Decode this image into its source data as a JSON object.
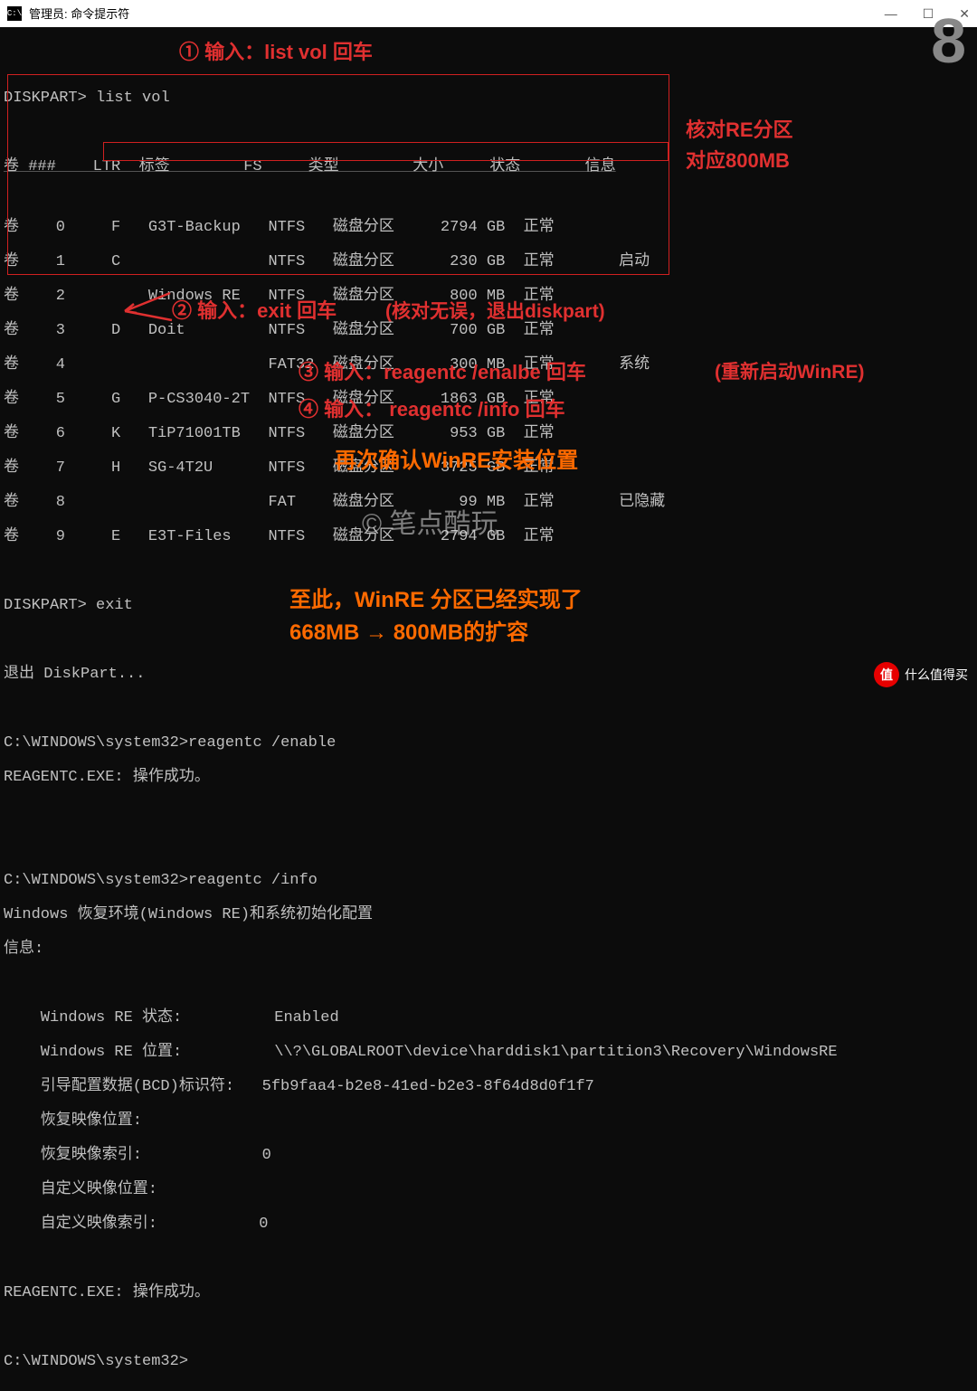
{
  "window": {
    "title": "管理员: 命令提示符",
    "icon_text": "C:\\"
  },
  "step_number": "8",
  "prompt1": "DISKPART> ",
  "command1": "list vol",
  "anno1": "① 输入：list vol 回车",
  "table_header": "卷 ###    LTR  标签        FS     类型        大小     状态       信息",
  "volumes": [
    {
      "line": "卷    0     F   G3T-Backup   NTFS   磁盘分区     2794 GB  正常"
    },
    {
      "line": "卷    1     C                NTFS   磁盘分区      230 GB  正常       启动"
    },
    {
      "line": "卷    2         Windows RE   NTFS   磁盘分区      800 MB  正常"
    },
    {
      "line": "卷    3     D   Doit         NTFS   磁盘分区      700 GB  正常"
    },
    {
      "line": "卷    4                      FAT32  磁盘分区      300 MB  正常       系统"
    },
    {
      "line": "卷    5     G   P-CS3040-2T  NTFS   磁盘分区     1863 GB  正常"
    },
    {
      "line": "卷    6     K   TiP71001TB   NTFS   磁盘分区      953 GB  正常"
    },
    {
      "line": "卷    7     H   SG-4T2U      NTFS   磁盘分区     3725 GB  正常"
    },
    {
      "line": "卷    8                      FAT    磁盘分区       99 MB  正常       已隐藏"
    },
    {
      "line": "卷    9     E   E3T-Files    NTFS   磁盘分区     2794 GB  正常"
    }
  ],
  "anno_check_re": "核对RE分区",
  "anno_check_re2": "对应800MB",
  "prompt2": "DISKPART> ",
  "command2": "exit",
  "exit_msg": "退出 DiskPart...",
  "anno2": "② 输入：exit 回车",
  "anno2_note": "(核对无误，退出diskpart)",
  "prompt3": "C:\\WINDOWS\\system32>",
  "command3": "reagentc /enable",
  "enable_result": "REAGENTC.EXE: 操作成功。",
  "anno3": "③ 输入：reagentc /enalbe 回车",
  "anno3_note": "(重新启动WinRE)",
  "prompt4": "C:\\WINDOWS\\system32>",
  "command4": "reagentc /info",
  "anno4": "④ 输入： reagentc /info 回车",
  "info_header": "Windows 恢复环境(Windows RE)和系统初始化配置",
  "info_label": "信息:",
  "anno_confirm": "再次确认WinRE安装位置",
  "info_rows": {
    "status_label": "    Windows RE 状态:          Enabled",
    "location_label": "    Windows RE 位置:          \\\\?\\GLOBALROOT\\device\\harddisk1\\partition3\\Recovery\\WindowsRE",
    "bcd_label": "    引导配置数据(BCD)标识符:   5fb9faa4-b2e8-41ed-b2e3-8f64d8d0f1f7",
    "recovery_img": "    恢复映像位置:",
    "recovery_idx": "    恢复映像索引:             0",
    "custom_img": "    自定义映像位置:",
    "custom_idx": "    自定义映像索引:           0"
  },
  "info_success": "REAGENTC.EXE: 操作成功。",
  "final_prompt": "C:\\WINDOWS\\system32>",
  "anno_final1": "至此，WinRE 分区已经实现了",
  "anno_final2": "668MB → 800MB的扩容",
  "watermark": "© 笔点酷玩",
  "watermark_corner": {
    "badge": "值",
    "text": "什么值得买"
  },
  "colors": {
    "red": "#e03030",
    "orange": "#ff6a00",
    "bg": "#0c0c0c"
  }
}
